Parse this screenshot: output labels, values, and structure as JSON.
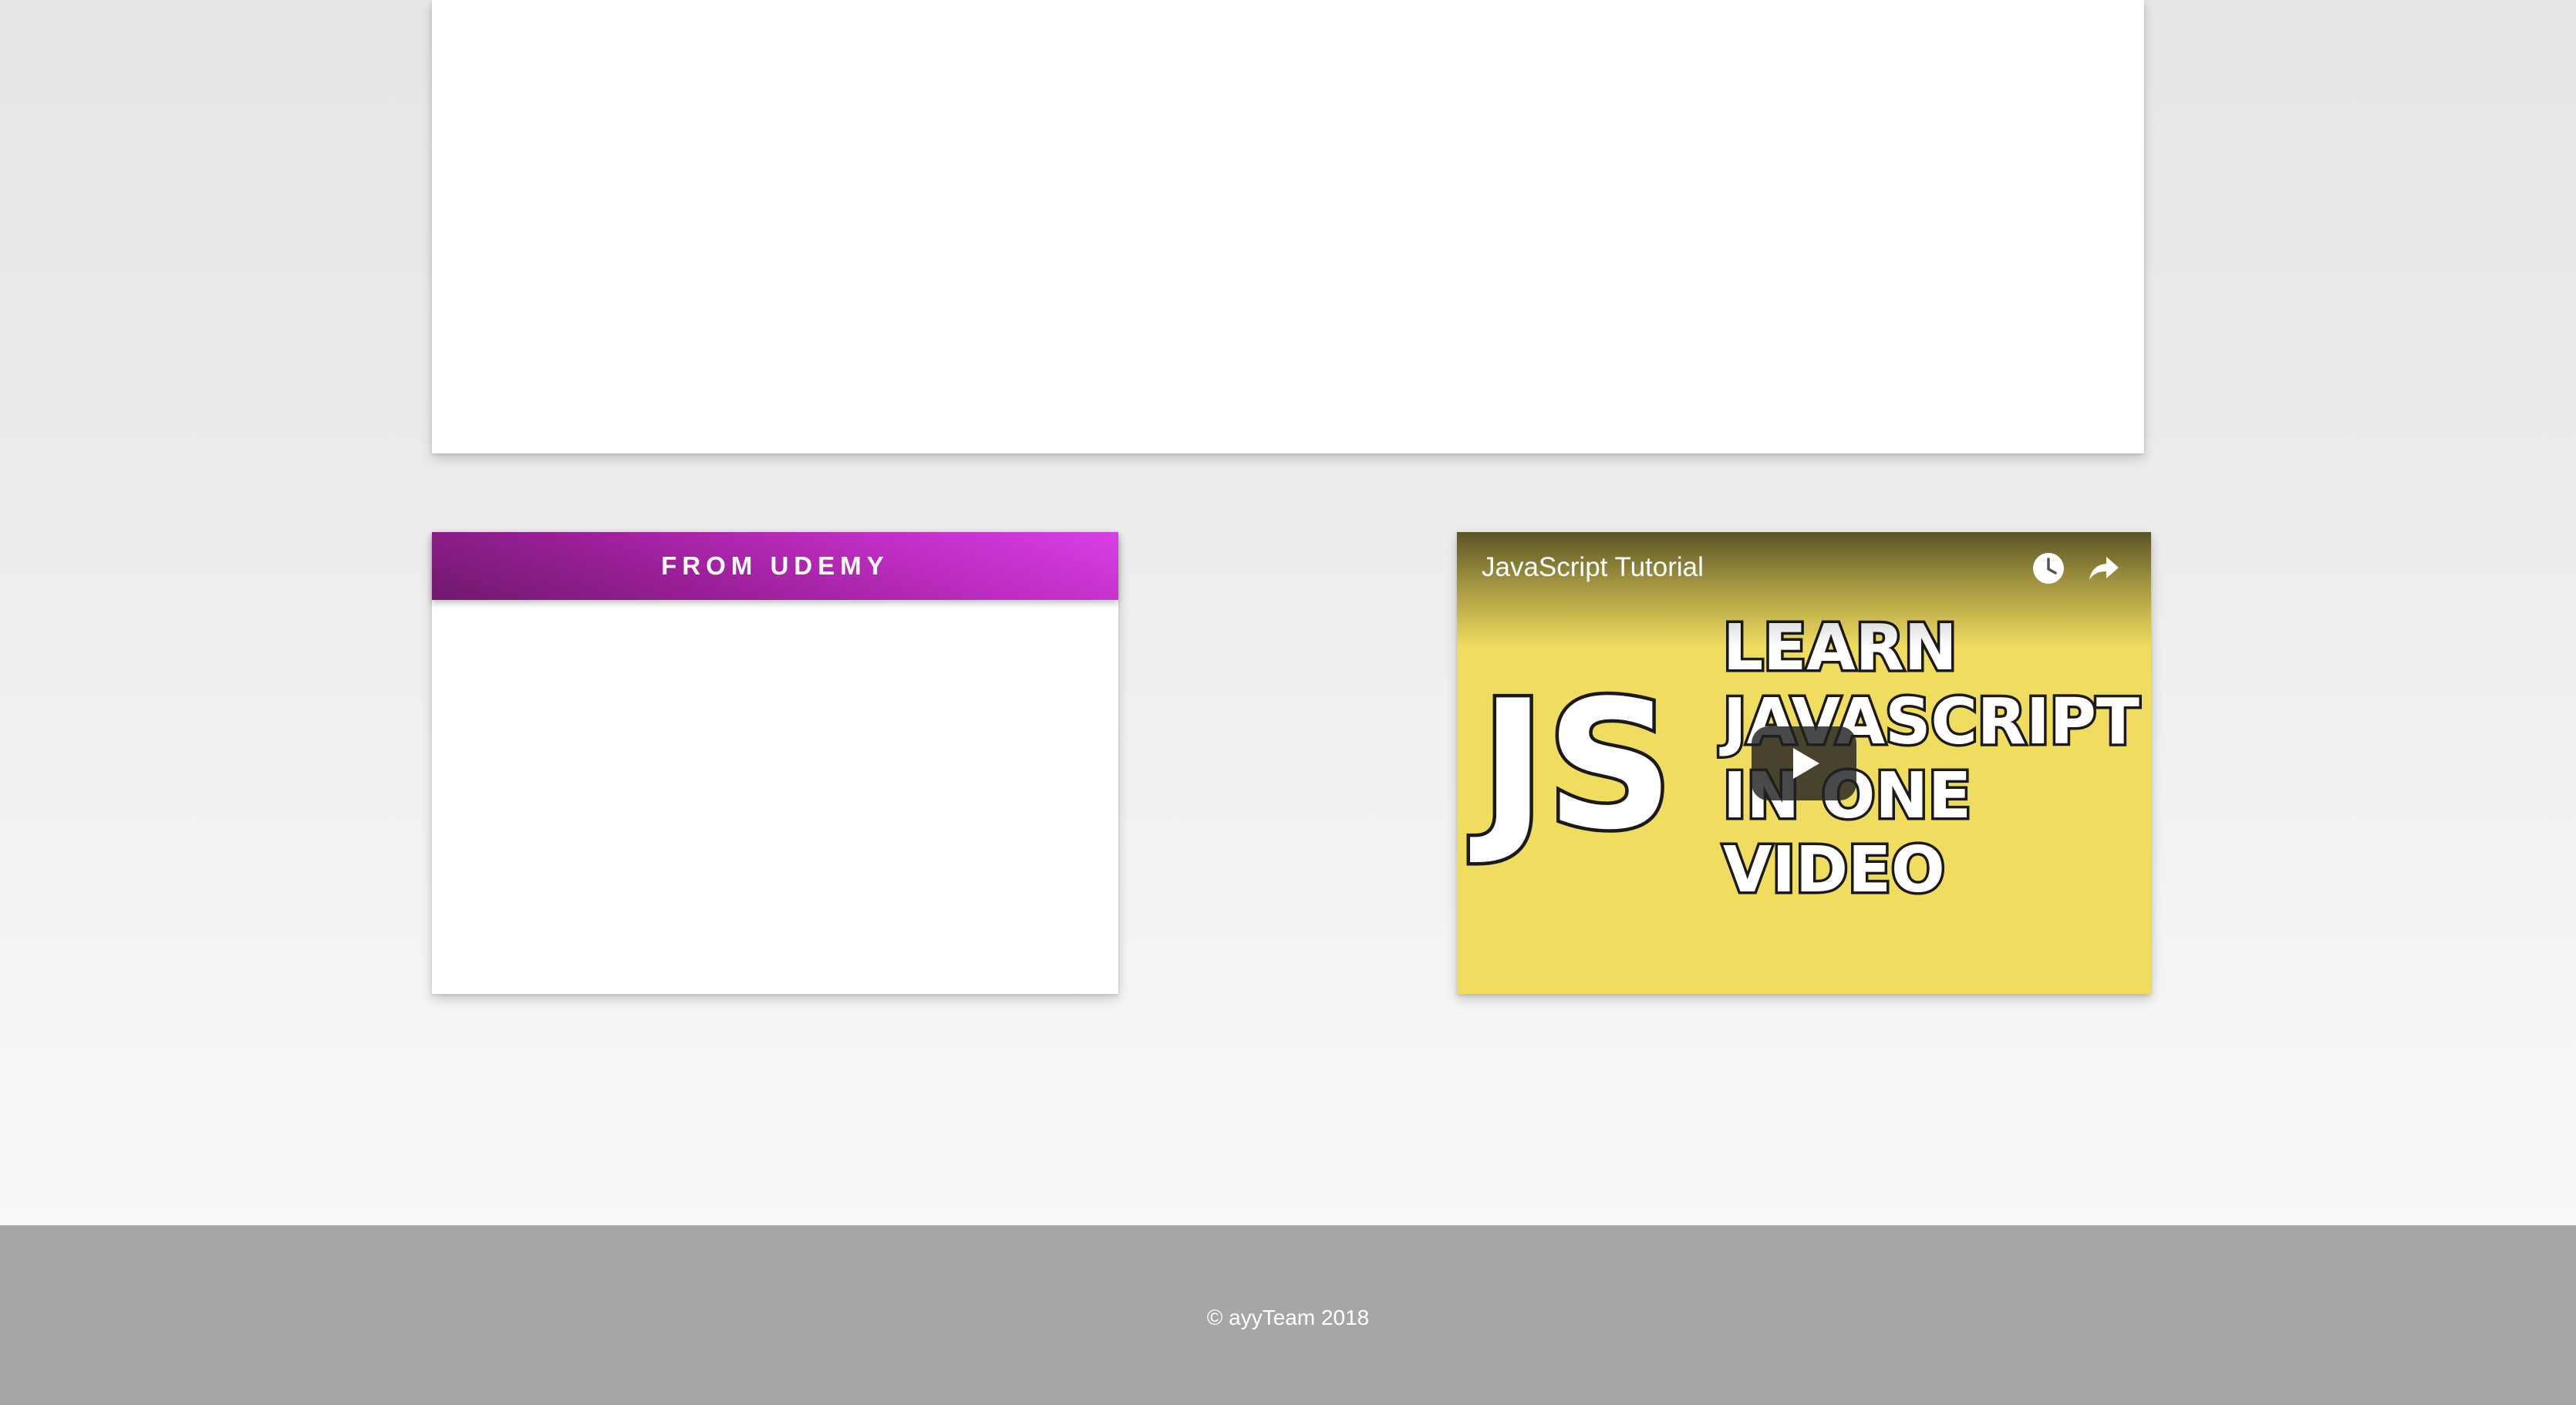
{
  "udemy_card": {
    "title": "FROM UDEMY",
    "header_gradient": [
      "#6f1a6c",
      "#d83fe6"
    ]
  },
  "video": {
    "title": "JavaScript Tutorial",
    "thumbnail_text": {
      "logo": "JS",
      "line1": "LEARN",
      "line2": "JAVASCRIPT",
      "line3": "IN ONE",
      "line4": "VIDEO"
    },
    "background_color": "#f0dc5f",
    "icons": {
      "watch_later": "clock-icon",
      "share": "share-icon",
      "play": "play-icon"
    }
  },
  "footer": {
    "copyright": "© ayyTeam 2018",
    "background_color": "#a6a6a6"
  }
}
